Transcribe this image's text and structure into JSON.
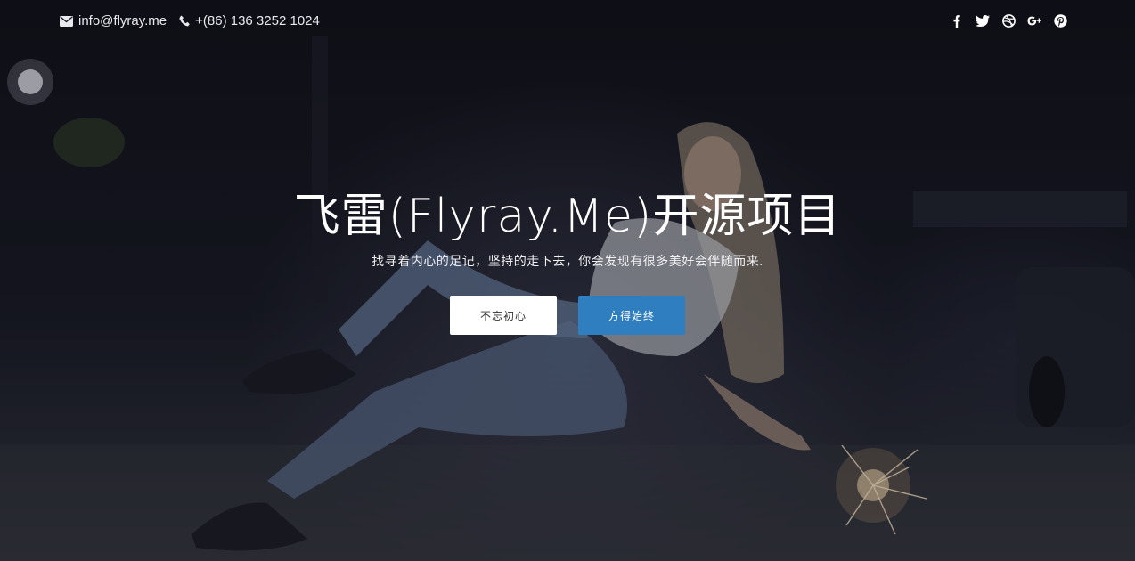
{
  "topbar": {
    "email": "info@flyray.me",
    "phone": "+(86) 136 3252 1024",
    "social": [
      {
        "icon": "facebook-icon"
      },
      {
        "icon": "twitter-icon"
      },
      {
        "icon": "dribbble-icon"
      },
      {
        "icon": "google-plus-icon"
      },
      {
        "icon": "pinterest-icon"
      }
    ]
  },
  "hero": {
    "title": "飞雷(Flyray.Me)开源项目",
    "subtitle": "找寻着内心的足记，坚持的走下去，你会发现有很多美好会伴随而来.",
    "primary_label": "不忘初心",
    "secondary_label": "方得始终"
  },
  "colors": {
    "accent": "#2f7fc0",
    "text": "#ffffff"
  }
}
